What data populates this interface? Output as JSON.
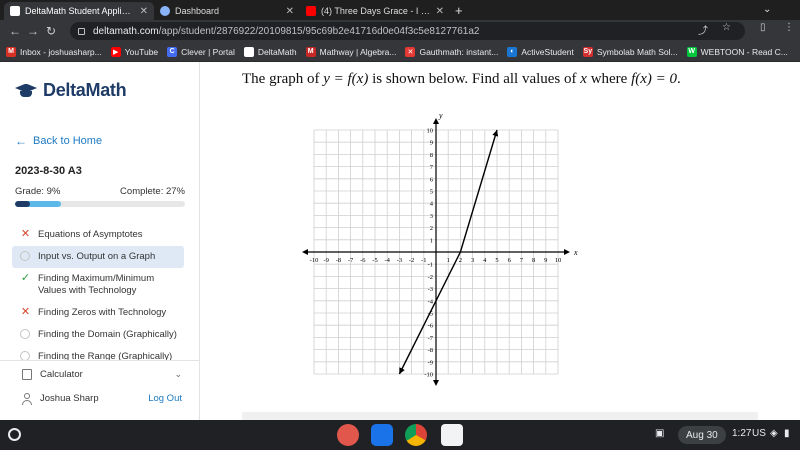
{
  "browser": {
    "tabs": [
      {
        "title": "DeltaMath Student Application",
        "active": true
      },
      {
        "title": "Dashboard",
        "active": false
      },
      {
        "title": "(4) Three Days Grace - I Hate",
        "active": false
      }
    ],
    "url_host": "deltamath.com",
    "url_path": "/app/student/2876922/20109815/95c69b2e41716d0e04f3c5e8127761a2",
    "bookmarks": [
      {
        "label": "Inbox - joshuasharp...",
        "icon": "gmail-icon",
        "color": "#d93025",
        "glyph": "M"
      },
      {
        "label": "YouTube",
        "icon": "youtube-icon",
        "color": "#ff0000",
        "glyph": "▶"
      },
      {
        "label": "Clever | Portal",
        "icon": "clever-icon",
        "color": "#436cf2",
        "glyph": "C"
      },
      {
        "label": "DeltaMath",
        "icon": "deltamath-icon",
        "color": "#ffffff",
        "glyph": ""
      },
      {
        "label": "Mathway | Algebra...",
        "icon": "mathway-icon",
        "color": "#c62828",
        "glyph": "M"
      },
      {
        "label": "Gauthmath: instant...",
        "icon": "gauthmath-icon",
        "color": "#e53935",
        "glyph": "✕"
      },
      {
        "label": "ActiveStudent",
        "icon": "activestudent-icon",
        "color": "#1976d2",
        "glyph": "◐"
      },
      {
        "label": "Symbolab Math Sol...",
        "icon": "symbolab-icon",
        "color": "#d32f2f",
        "glyph": "Sy"
      },
      {
        "label": "WEBTOON - Read C...",
        "icon": "webtoon-icon",
        "color": "#00c73c",
        "glyph": "W"
      }
    ]
  },
  "sidebar": {
    "logo": "DeltaMath",
    "back_label": "Back to Home",
    "assignment_title": "2023-8-30 A3",
    "grade_label": "Grade: 9%",
    "complete_label": "Complete: 27%",
    "grade_fraction": 0.09,
    "complete_fraction": 0.27,
    "skills": [
      {
        "label": "Equations of Asymptotes",
        "status": "x",
        "active": false
      },
      {
        "label": "Input vs. Output on a Graph",
        "status": "circle",
        "active": true
      },
      {
        "label": "Finding Maximum/Minimum Values with Technology",
        "status": "check",
        "active": false
      },
      {
        "label": "Finding Zeros with Technology",
        "status": "x",
        "active": false
      },
      {
        "label": "Finding the Domain (Graphically)",
        "status": "circle",
        "active": false
      },
      {
        "label": "Finding the Range (Graphically)",
        "status": "circle",
        "active": false
      }
    ],
    "calculator_label": "Calculator",
    "user_name": "Joshua Sharp",
    "logout_label": "Log Out"
  },
  "question": {
    "prefix": "The graph of ",
    "eq1": "y = f(x)",
    "middle": " is shown below. Find all values of ",
    "var": "x",
    "where": " where ",
    "eq2": "f(x) = 0",
    "suffix": "."
  },
  "chart_data": {
    "type": "line",
    "xlabel": "x",
    "ylabel": "y",
    "xlim": [
      -10,
      10
    ],
    "ylim": [
      -10,
      10
    ],
    "grid": true,
    "x_ticks": [
      -10,
      -9,
      -8,
      -7,
      -6,
      -5,
      -4,
      -3,
      -2,
      -1,
      1,
      2,
      3,
      4,
      5,
      6,
      7,
      8,
      9,
      10
    ],
    "y_ticks": [
      10,
      9,
      8,
      7,
      6,
      5,
      4,
      3,
      2,
      1,
      -1,
      -2,
      -3,
      -4,
      -5,
      -6,
      -7,
      -8,
      -9,
      -10
    ],
    "series": [
      {
        "x": [
          -3,
          0,
          2,
          5
        ],
        "y": [
          -10,
          -4,
          0,
          10
        ]
      }
    ]
  },
  "taskbar": {
    "date": "Aug 30",
    "time": "1:27",
    "locale": "US"
  }
}
